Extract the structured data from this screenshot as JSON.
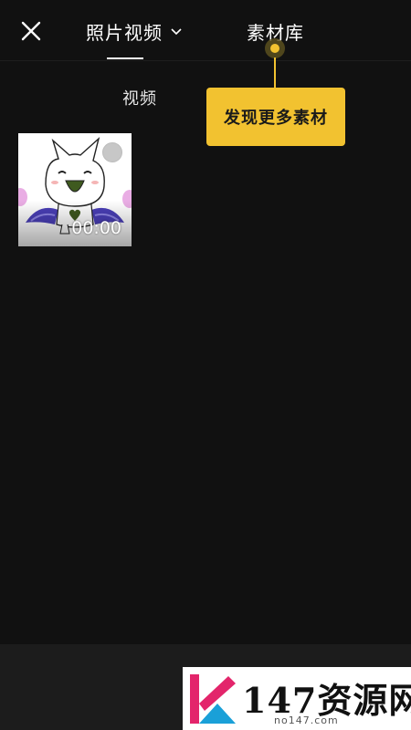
{
  "header": {
    "close_icon": "close-icon",
    "tab_photos_videos": "照片视频",
    "tab_library": "素材库"
  },
  "tooltip": {
    "text": "发现更多素材",
    "color": "#f2c230"
  },
  "content": {
    "section_title": "视频",
    "media": [
      {
        "duration": "00:00",
        "selected": false
      }
    ]
  },
  "watermark": {
    "title": "147资源网",
    "url": "no147.com"
  },
  "colors": {
    "background": "#111111",
    "bottom_bar": "#1c1c1c",
    "accent": "#f2c230"
  }
}
